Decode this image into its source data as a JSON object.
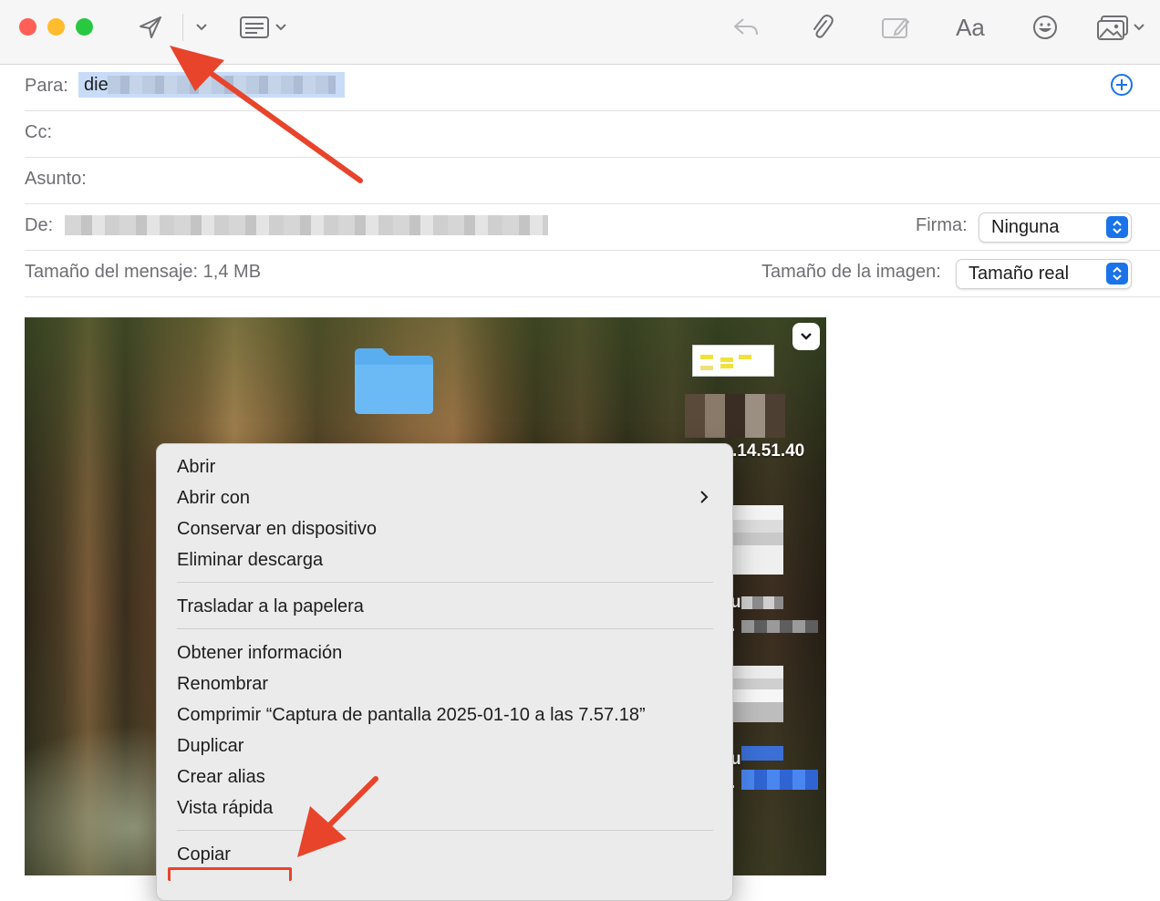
{
  "toolbar": {
    "icons": [
      "send-icon",
      "chevron-down-icon",
      "header-fields-icon",
      "reply-icon",
      "paperclip-icon",
      "markup-icon",
      "font-icon",
      "emoji-icon",
      "photo-browser-icon"
    ],
    "font_label": "Aa"
  },
  "header": {
    "to_label": "Para:",
    "to_value": "die",
    "cc_label": "Cc:",
    "subject_label": "Asunto:",
    "from_label": "De:",
    "signature_label": "Firma:",
    "signature_value": "Ninguna",
    "message_size_label": "Tamaño del mensaje:",
    "message_size_value": "1,4 MB",
    "image_size_label": "Tamaño de la imagen:",
    "image_size_value": "Tamaño real"
  },
  "desktop": {
    "visible_time_fragment": ".14.51.40",
    "text_fragment_1": "u",
    "text_fragment_2": ".",
    "text_fragment_3": "u",
    "text_fragment_4": "."
  },
  "context_menu": {
    "items": [
      "Abrir",
      "Abrir con",
      "Conservar en dispositivo",
      "Eliminar descarga",
      "Trasladar a la papelera",
      "Obtener información",
      "Renombrar",
      "Comprimir “Captura de pantalla 2025-01-10 a las 7.57.18”",
      "Duplicar",
      "Crear alias",
      "Vista rápida",
      "Copiar"
    ]
  },
  "colors": {
    "annotation_arrow": "#e8442b",
    "accent": "#1a73e8",
    "recipient_highlight": "#c8dcf7"
  }
}
